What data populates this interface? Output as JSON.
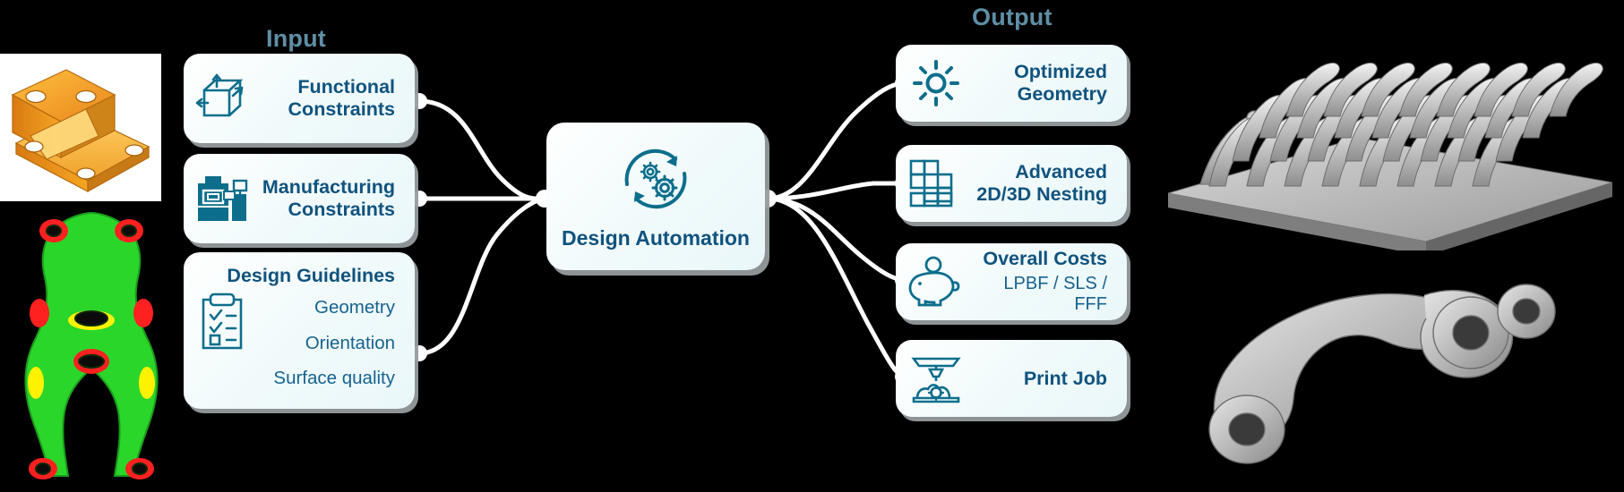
{
  "diagram": {
    "background": "#000000",
    "accent_icon": "#0d6e8c",
    "accent_text": "#10537e",
    "header_color": "#5f8fa6",
    "card_bg": "#f0fafb",
    "connector_color": "#ffffff"
  },
  "headers": {
    "input": "Input",
    "output": "Output"
  },
  "input_cards": [
    {
      "id": "functional-constraints",
      "icon": "cube-arrows-icon",
      "line1": "Functional",
      "line2": "Constraints"
    },
    {
      "id": "manufacturing-constraints",
      "icon": "machine-icon",
      "line1": "Manufacturing",
      "line2": "Constraints"
    }
  ],
  "guidelines_card": {
    "id": "design-guidelines",
    "icon": "checklist-clipboard-icon",
    "title": "Design Guidelines",
    "items": [
      "Geometry",
      "Orientation",
      "Surface quality"
    ]
  },
  "hub": {
    "id": "design-automation",
    "icon": "cycle-gears-icon",
    "label": "Design Automation"
  },
  "output_cards": [
    {
      "id": "optimized-geometry",
      "icon": "gear-icon",
      "line1": "Optimized",
      "line2": "Geometry",
      "sub": ""
    },
    {
      "id": "advanced-nesting",
      "icon": "nesting-blocks-icon",
      "line1": "Advanced",
      "line2": "2D/3D Nesting",
      "sub": ""
    },
    {
      "id": "overall-costs",
      "icon": "piggy-bank-icon",
      "line1": "Overall Costs",
      "line2": "",
      "sub": "LPBF / SLS / FFF"
    },
    {
      "id": "print-job",
      "icon": "printer-nozzle-icon",
      "line1": "Print Job",
      "line2": "",
      "sub": ""
    }
  ],
  "images": {
    "cad_bracket": "orange-cad-bracket-image",
    "fea_result": "green-red-topology-result-image",
    "build_plate": "metal-build-plate-parts-image",
    "printed_part": "printed-metal-bracket-image"
  }
}
